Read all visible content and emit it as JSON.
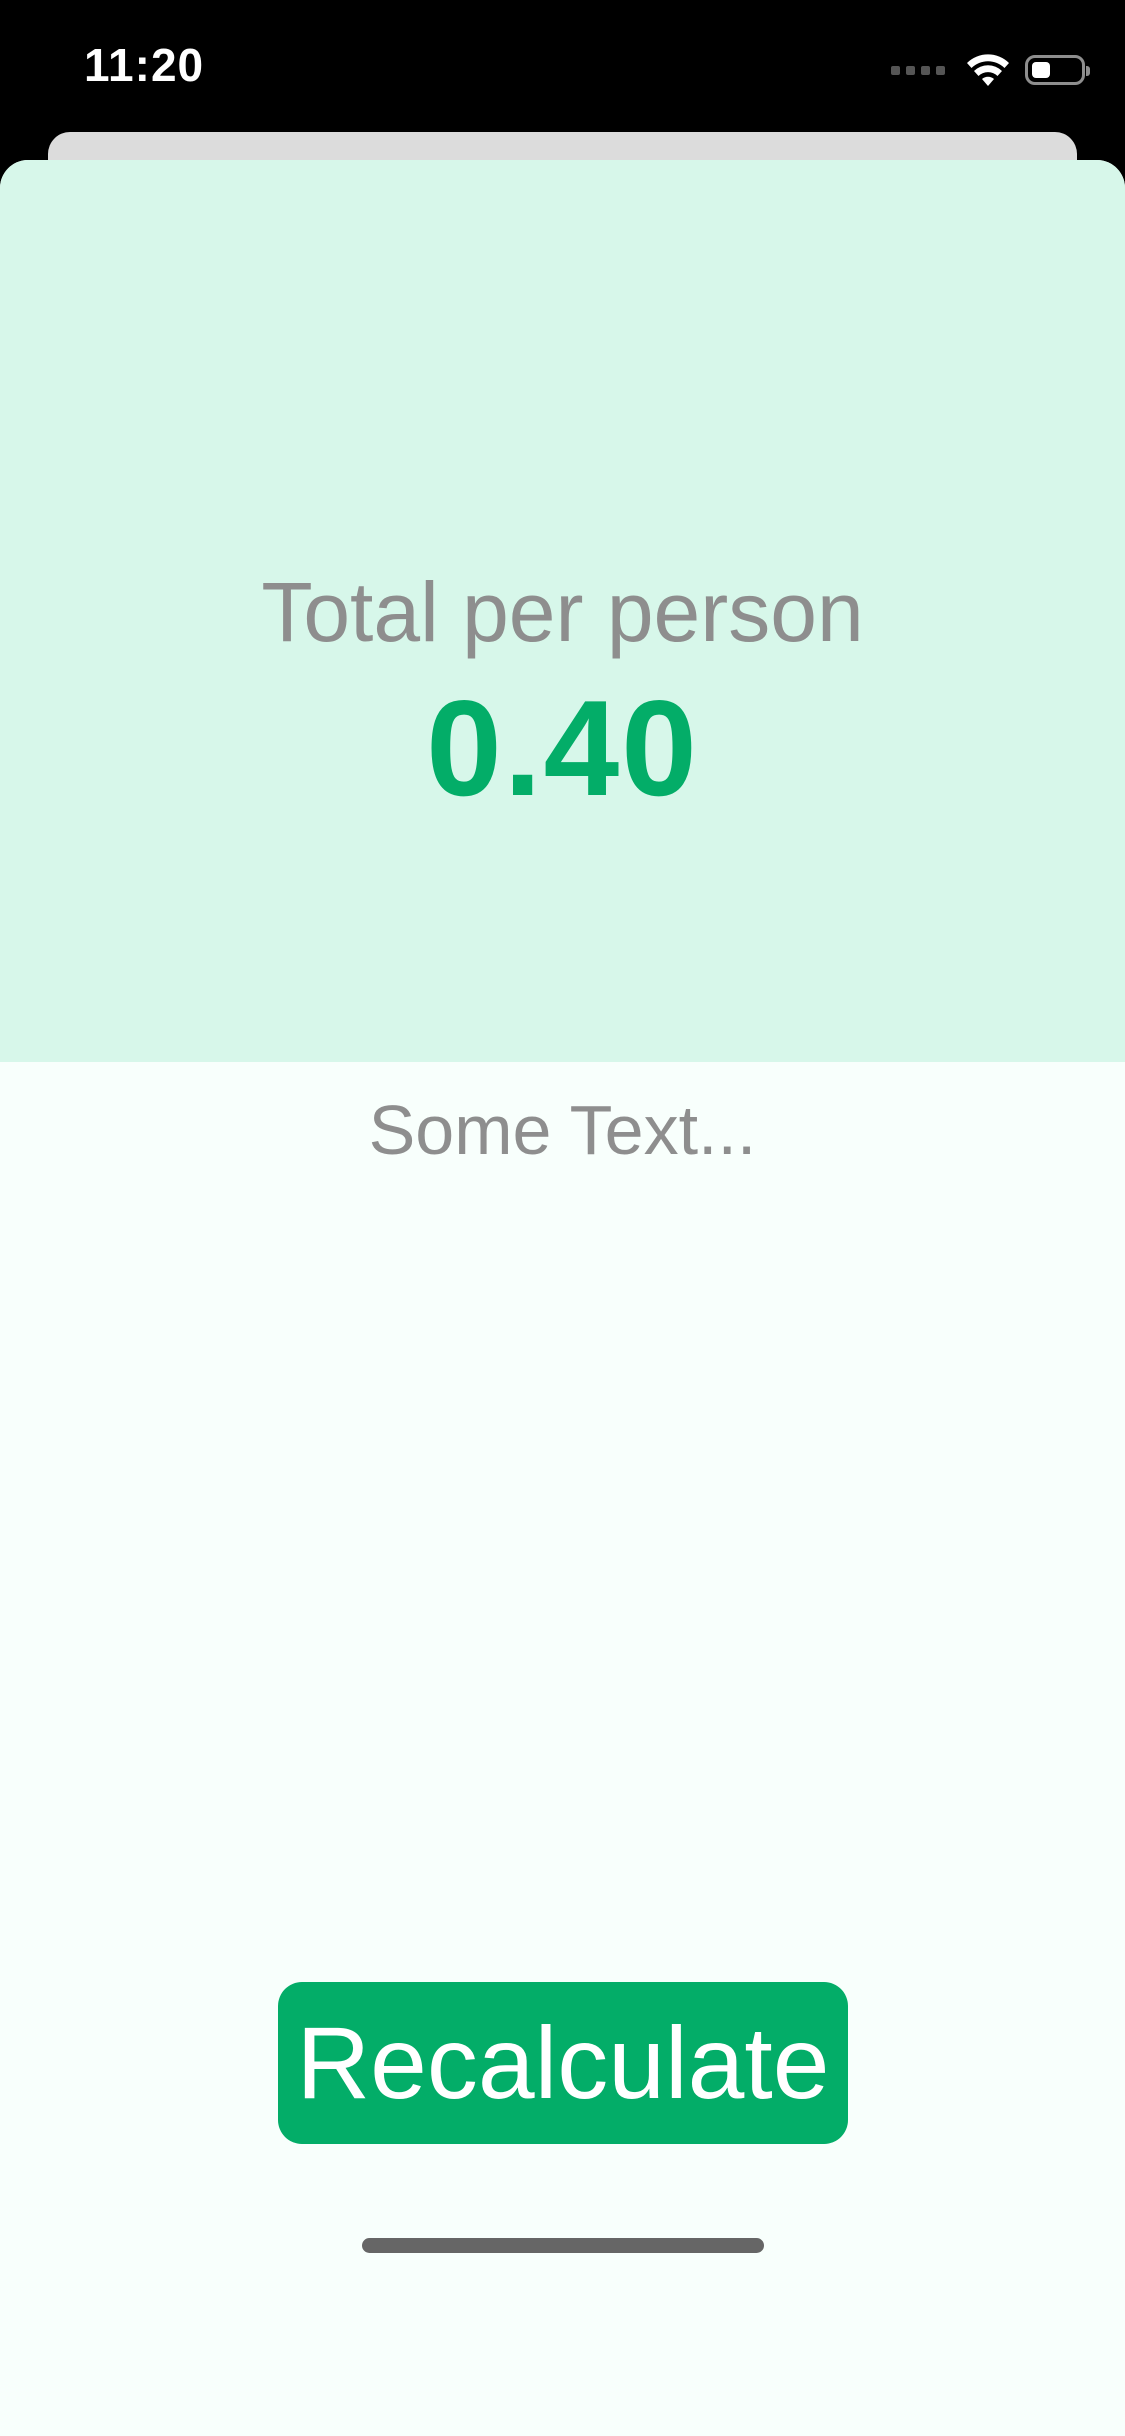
{
  "status_bar": {
    "time": "11:20",
    "battery_level": 0.4
  },
  "result": {
    "label": "Total per person",
    "value": "0.40"
  },
  "info": {
    "text": "Some Text..."
  },
  "actions": {
    "recalculate_label": "Recalculate"
  },
  "colors": {
    "accent": "#03ad68",
    "result_background": "#d7f7ea",
    "sheet_background": "#f8fffc",
    "secondary_text": "#8e8e8e"
  }
}
